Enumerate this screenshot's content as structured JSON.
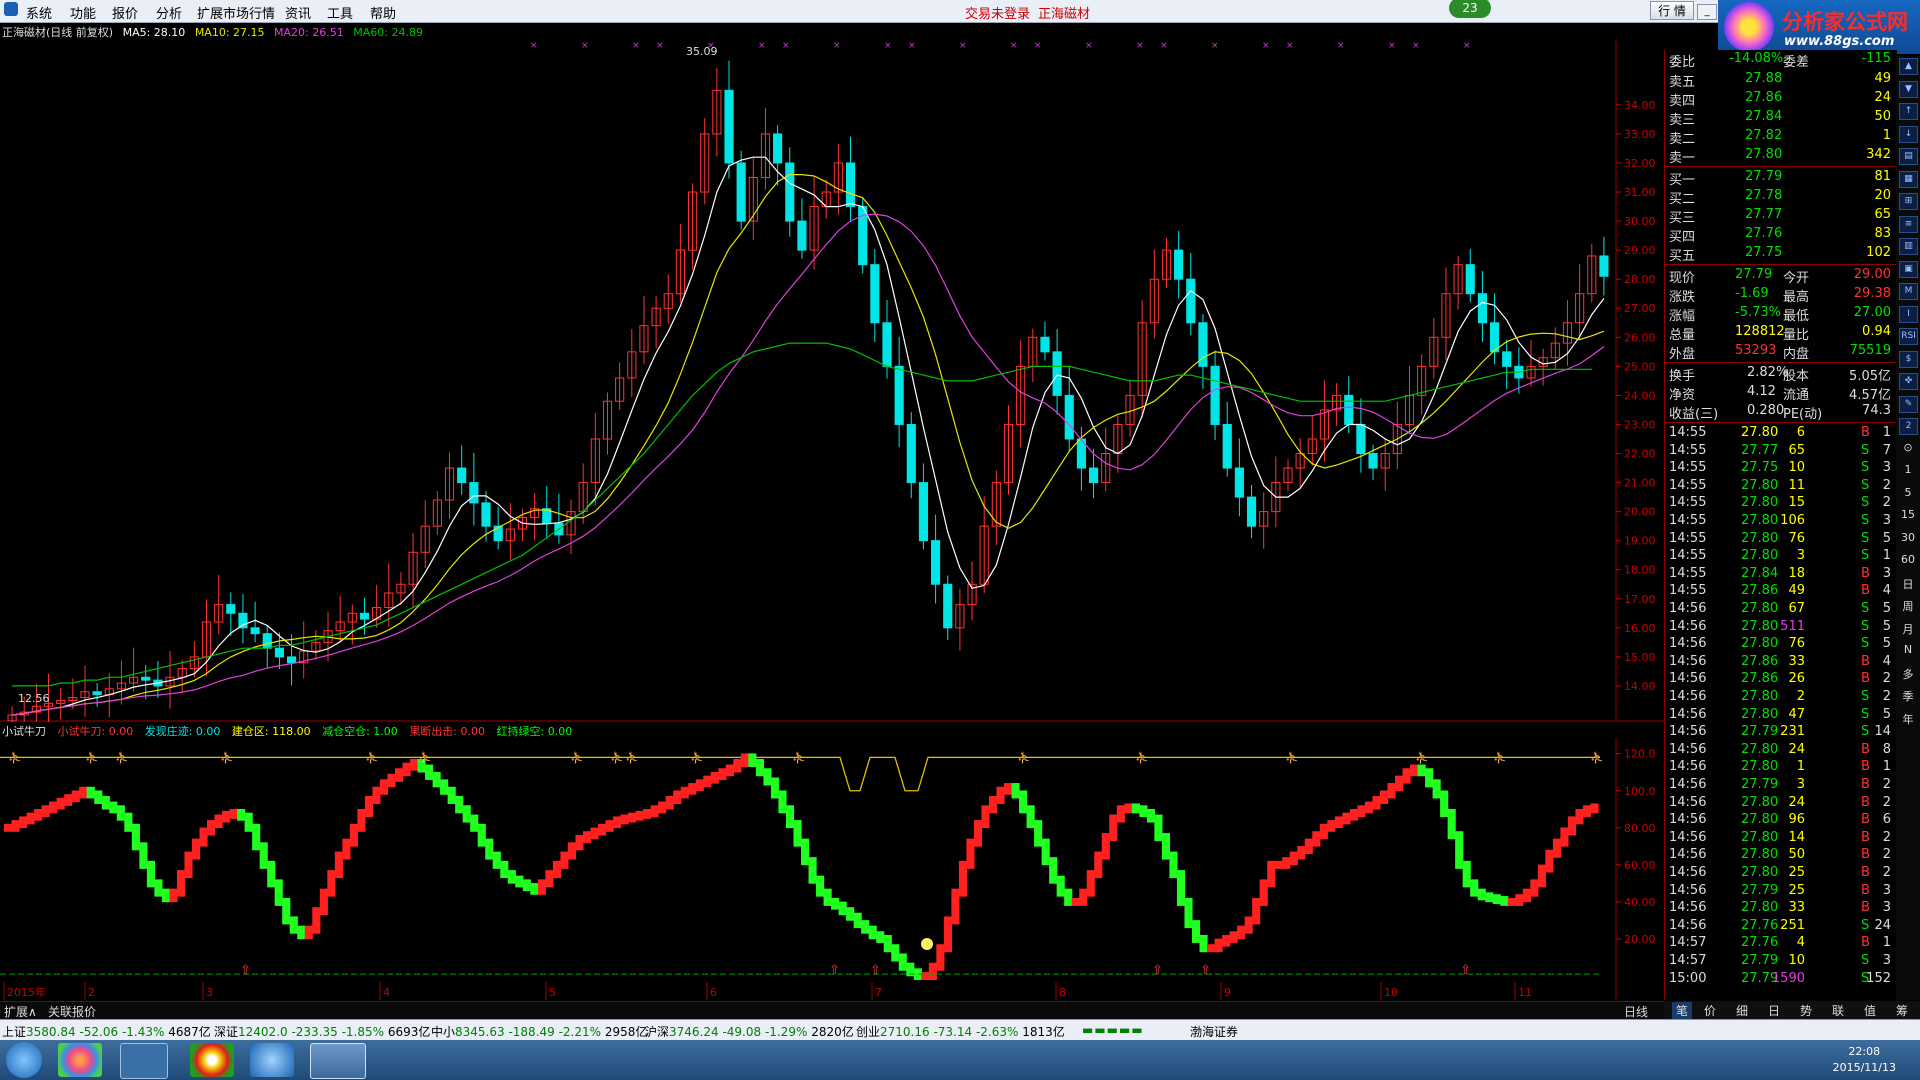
{
  "menu": {
    "items": [
      "系统",
      "功能",
      "报价",
      "分析",
      "扩展市场行情",
      "资讯",
      "工具",
      "帮助"
    ],
    "notice_login": "交易未登录",
    "notice_stock": "正海磁材",
    "bubble_count": "23",
    "hq_button": "行 情",
    "logo_text": "分析家公式网",
    "logo_url": "www.88gs.com",
    "window_controls": [
      "_",
      "▫",
      "×"
    ]
  },
  "main_chart": {
    "title": "正海磁材(日线 前复权)",
    "ma5": "MA5: 28.10",
    "ma10": "MA10: 27.15",
    "ma20": "MA20: 26.51",
    "ma60": "MA60: 24.89",
    "high_label": "35.09",
    "low_label": "12.56",
    "colors": {
      "up": "#ff3333",
      "down": "#00e5e5",
      "ma5": "#ffffff",
      "ma10": "#e6e600",
      "ma20": "#e040e0",
      "ma60": "#00c000",
      "axis": "#cc0000"
    }
  },
  "indicator": {
    "name": "小试牛刀",
    "params": [
      {
        "label": "小试牛刀: 0.00",
        "color": "#ff3333"
      },
      {
        "label": "发现庄迹: 0.00",
        "color": "#00e5e5"
      },
      {
        "label": "建仓区: 118.00",
        "color": "#ffff00"
      },
      {
        "label": "减仓空仓: 1.00",
        "color": "#00ff00"
      },
      {
        "label": "果断出击: 0.00",
        "color": "#ff3333"
      },
      {
        "label": "红持绿空: 0.00",
        "color": "#00ff00"
      }
    ]
  },
  "chart_data": [
    {
      "type": "candlestick",
      "title": "正海磁材(日线 前复权)",
      "y_ticks": [
        "34.00",
        "33.00",
        "32.00",
        "31.00",
        "30.00",
        "29.00",
        "28.00",
        "27.00",
        "26.00",
        "25.00",
        "24.00",
        "23.00",
        "22.00",
        "21.00",
        "20.00",
        "19.00",
        "18.00",
        "17.00",
        "16.00",
        "15.00",
        "14.00"
      ],
      "ylim": [
        13.0,
        35.2
      ],
      "x_labels": [
        "2015年",
        "2",
        "3",
        "4",
        "5",
        "6",
        "7",
        "8",
        "9",
        "10",
        "11"
      ],
      "close": [
        13.0,
        13.1,
        13.3,
        13.4,
        13.5,
        13.6,
        13.8,
        13.7,
        13.9,
        14.1,
        14.3,
        14.2,
        14.0,
        14.3,
        14.6,
        15.0,
        16.2,
        16.8,
        16.5,
        16.0,
        15.8,
        15.3,
        15.0,
        14.8,
        15.2,
        15.5,
        15.9,
        16.2,
        16.5,
        16.3,
        16.7,
        17.2,
        17.5,
        18.6,
        19.5,
        20.4,
        21.5,
        21.0,
        20.3,
        19.5,
        19.0,
        19.4,
        19.8,
        20.1,
        19.6,
        19.2,
        20.0,
        21.0,
        22.5,
        23.8,
        24.6,
        25.5,
        26.4,
        27.0,
        27.5,
        29.0,
        31.0,
        33.0,
        34.5,
        32.0,
        30.0,
        31.5,
        33.0,
        32.0,
        30.0,
        29.0,
        30.5,
        31.0,
        32.0,
        30.5,
        28.5,
        26.5,
        25.0,
        23.0,
        21.0,
        19.0,
        17.5,
        16.0,
        16.8,
        17.5,
        19.5,
        21.0,
        23.0,
        25.0,
        26.0,
        25.5,
        24.0,
        22.5,
        21.5,
        21.0,
        22.0,
        23.0,
        24.0,
        26.5,
        28.0,
        29.0,
        28.0,
        26.5,
        25.0,
        23.0,
        21.5,
        20.5,
        19.5,
        20.0,
        21.0,
        21.5,
        22.0,
        22.5,
        23.5,
        24.0,
        23.0,
        22.0,
        21.5,
        22.0,
        23.0,
        24.0,
        25.0,
        26.0,
        27.5,
        28.5,
        27.5,
        26.5,
        25.5,
        25.0,
        24.6,
        25.0,
        25.3,
        25.8,
        26.5,
        27.5,
        28.8,
        28.1
      ],
      "ma60_approx": [
        14.0,
        14.0,
        14.0,
        14.0,
        14.1,
        14.1,
        14.2,
        14.2,
        14.3,
        14.3,
        14.4,
        14.5,
        14.6,
        14.7,
        14.8,
        14.9,
        15.0,
        15.1,
        15.2,
        15.3,
        15.3,
        15.3,
        15.4,
        15.4,
        15.5,
        15.6,
        15.7,
        15.8,
        15.9,
        16.0,
        16.1,
        16.3,
        16.5,
        16.7,
        16.9,
        17.1,
        17.3,
        17.5,
        17.7,
        17.9,
        18.1,
        18.3,
        18.5,
        18.8,
        19.1,
        19.4,
        19.7,
        20.0,
        20.4,
        20.8,
        21.2,
        21.6,
        22.0,
        22.5,
        23.0,
        23.5,
        24.0,
        24.4,
        24.8,
        25.1,
        25.3,
        25.5,
        25.6,
        25.7,
        25.8,
        25.8,
        25.8,
        25.8,
        25.7,
        25.6,
        25.4,
        25.2,
        25.0,
        24.9,
        24.8,
        24.7,
        24.6,
        24.5,
        24.5,
        24.5,
        24.6,
        24.7,
        24.8,
        24.9,
        25.0,
        25.0,
        25.0,
        25.0,
        24.9,
        24.8,
        24.7,
        24.6,
        24.5,
        24.5,
        24.5,
        24.6,
        24.7,
        24.7,
        24.6,
        24.5,
        24.4,
        24.3,
        24.2,
        24.1,
        24.0,
        23.9,
        23.8,
        23.8,
        23.8,
        23.8,
        23.8,
        23.8,
        23.8,
        23.8,
        23.9,
        24.0,
        24.1,
        24.2,
        24.3,
        24.4,
        24.5,
        24.6,
        24.7,
        24.8,
        24.8,
        24.9,
        24.9,
        24.9,
        24.9,
        24.9,
        24.9
      ]
    },
    {
      "type": "line",
      "title": "小试牛刀",
      "y_ticks": [
        "120.0",
        "100.0",
        "80.00",
        "60.00",
        "40.00",
        "20.00"
      ],
      "ylim": [
        0,
        122
      ],
      "values": [
        80,
        82,
        84,
        86,
        88,
        90,
        92,
        94,
        96,
        98,
        100,
        98,
        95,
        92,
        90,
        86,
        80,
        70,
        60,
        50,
        45,
        42,
        45,
        55,
        65,
        72,
        78,
        82,
        85,
        87,
        88,
        86,
        80,
        70,
        60,
        50,
        40,
        30,
        25,
        22,
        25,
        35,
        45,
        55,
        65,
        72,
        80,
        88,
        95,
        100,
        104,
        107,
        110,
        113,
        115,
        112,
        108,
        104,
        100,
        95,
        90,
        85,
        80,
        72,
        65,
        60,
        55,
        52,
        50,
        48,
        46,
        50,
        55,
        60,
        65,
        70,
        74,
        76,
        78,
        80,
        82,
        84,
        85,
        86,
        87,
        88,
        90,
        92,
        95,
        98,
        100,
        102,
        104,
        106,
        108,
        110,
        112,
        115,
        118,
        115,
        110,
        105,
        98,
        90,
        82,
        72,
        62,
        52,
        45,
        40,
        38,
        35,
        32,
        28,
        25,
        22,
        20,
        15,
        10,
        5,
        2,
        0,
        0,
        5,
        15,
        30,
        45,
        60,
        72,
        82,
        90,
        95,
        100,
        102,
        98,
        90,
        82,
        72,
        62,
        52,
        45,
        40,
        40,
        45,
        55,
        65,
        75,
        85,
        90,
        91,
        90,
        88,
        85,
        75,
        65,
        55,
        40,
        28,
        20,
        15,
        15,
        18,
        20,
        22,
        25,
        30,
        40,
        50,
        60,
        60,
        62,
        65,
        68,
        72,
        76,
        80,
        82,
        84,
        86,
        88,
        90,
        92,
        95,
        98,
        102,
        106,
        110,
        112,
        110,
        104,
        98,
        88,
        76,
        60,
        50,
        45,
        43,
        42,
        41,
        40,
        40,
        42,
        45,
        50,
        58,
        66,
        72,
        78,
        84,
        88,
        90,
        91
      ]
    }
  ],
  "quote_panel": {
    "weibi": {
      "label": "委比",
      "value": "-14.08%",
      "label2": "委差",
      "value2": "-115"
    },
    "sells": [
      {
        "label": "卖五",
        "price": "27.88",
        "vol": "49"
      },
      {
        "label": "卖四",
        "price": "27.86",
        "vol": "24"
      },
      {
        "label": "卖三",
        "price": "27.84",
        "vol": "50"
      },
      {
        "label": "卖二",
        "price": "27.82",
        "vol": "1"
      },
      {
        "label": "卖一",
        "price": "27.80",
        "vol": "342"
      }
    ],
    "buys": [
      {
        "label": "买一",
        "price": "27.79",
        "vol": "81"
      },
      {
        "label": "买二",
        "price": "27.78",
        "vol": "20"
      },
      {
        "label": "买三",
        "price": "27.77",
        "vol": "65"
      },
      {
        "label": "买四",
        "price": "27.76",
        "vol": "83"
      },
      {
        "label": "买五",
        "price": "27.75",
        "vol": "102"
      }
    ],
    "stats": [
      {
        "l1": "现价",
        "v1": "27.79",
        "c1": "#00e000",
        "l2": "今开",
        "v2": "29.00",
        "c2": "#ff3333"
      },
      {
        "l1": "涨跌",
        "v1": "-1.69",
        "c1": "#00e000",
        "l2": "最高",
        "v2": "29.38",
        "c2": "#ff3333"
      },
      {
        "l1": "涨幅",
        "v1": "-5.73%",
        "c1": "#00e000",
        "l2": "最低",
        "v2": "27.00",
        "c2": "#00e000"
      },
      {
        "l1": "总量",
        "v1": "128812",
        "c1": "#ffff00",
        "l2": "量比",
        "v2": "0.94",
        "c2": "#ffff00"
      },
      {
        "l1": "外盘",
        "v1": "53293",
        "c1": "#ff3333",
        "l2": "内盘",
        "v2": "75519",
        "c2": "#00e000"
      }
    ],
    "fund": [
      {
        "l1": "换手",
        "v1": "2.82%",
        "l2": "股本",
        "v2": "5.05亿"
      },
      {
        "l1": "净资",
        "v1": "4.12",
        "l2": "流通",
        "v2": "4.57亿"
      },
      {
        "l1": "收益(三)",
        "v1": "0.280",
        "l2": "PE(动)",
        "v2": "74.3"
      }
    ],
    "ticks": [
      {
        "t": "14:55",
        "p": "27.80",
        "v": "6",
        "bs": "B",
        "n": "1",
        "pc": "#ffff00",
        "vc": "#ffff00"
      },
      {
        "t": "14:55",
        "p": "27.77",
        "v": "65",
        "bs": "S",
        "n": "7",
        "pc": "#00e000",
        "vc": "#ffff00"
      },
      {
        "t": "14:55",
        "p": "27.75",
        "v": "10",
        "bs": "S",
        "n": "3",
        "pc": "#00e000",
        "vc": "#ffff00"
      },
      {
        "t": "14:55",
        "p": "27.80",
        "v": "11",
        "bs": "S",
        "n": "2",
        "pc": "#00e000",
        "vc": "#ffff00"
      },
      {
        "t": "14:55",
        "p": "27.80",
        "v": "15",
        "bs": "S",
        "n": "2",
        "pc": "#00e000",
        "vc": "#ffff00"
      },
      {
        "t": "14:55",
        "p": "27.80",
        "v": "106",
        "bs": "S",
        "n": "3",
        "pc": "#00e000",
        "vc": "#ffff00"
      },
      {
        "t": "14:55",
        "p": "27.80",
        "v": "76",
        "bs": "S",
        "n": "5",
        "pc": "#00e000",
        "vc": "#ffff00"
      },
      {
        "t": "14:55",
        "p": "27.80",
        "v": "3",
        "bs": "S",
        "n": "1",
        "pc": "#00e000",
        "vc": "#ffff00"
      },
      {
        "t": "14:55",
        "p": "27.84",
        "v": "18",
        "bs": "B",
        "n": "3",
        "pc": "#00e000",
        "vc": "#ffff00"
      },
      {
        "t": "14:55",
        "p": "27.86",
        "v": "49",
        "bs": "B",
        "n": "4",
        "pc": "#00e000",
        "vc": "#ffff00"
      },
      {
        "t": "14:56",
        "p": "27.80",
        "v": "67",
        "bs": "S",
        "n": "5",
        "pc": "#00e000",
        "vc": "#ffff00"
      },
      {
        "t": "14:56",
        "p": "27.80",
        "v": "511",
        "bs": "S",
        "n": "5",
        "pc": "#00e000",
        "vc": "#e040e0"
      },
      {
        "t": "14:56",
        "p": "27.80",
        "v": "76",
        "bs": "S",
        "n": "5",
        "pc": "#00e000",
        "vc": "#ffff00"
      },
      {
        "t": "14:56",
        "p": "27.86",
        "v": "33",
        "bs": "B",
        "n": "4",
        "pc": "#00e000",
        "vc": "#ffff00"
      },
      {
        "t": "14:56",
        "p": "27.86",
        "v": "26",
        "bs": "B",
        "n": "2",
        "pc": "#00e000",
        "vc": "#ffff00"
      },
      {
        "t": "14:56",
        "p": "27.80",
        "v": "2",
        "bs": "S",
        "n": "2",
        "pc": "#00e000",
        "vc": "#ffff00"
      },
      {
        "t": "14:56",
        "p": "27.80",
        "v": "47",
        "bs": "S",
        "n": "5",
        "pc": "#00e000",
        "vc": "#ffff00"
      },
      {
        "t": "14:56",
        "p": "27.79",
        "v": "231",
        "bs": "S",
        "n": "14",
        "pc": "#00e000",
        "vc": "#ffff00"
      },
      {
        "t": "14:56",
        "p": "27.80",
        "v": "24",
        "bs": "B",
        "n": "8",
        "pc": "#00e000",
        "vc": "#ffff00"
      },
      {
        "t": "14:56",
        "p": "27.80",
        "v": "1",
        "bs": "B",
        "n": "1",
        "pc": "#00e000",
        "vc": "#ffff00"
      },
      {
        "t": "14:56",
        "p": "27.79",
        "v": "3",
        "bs": "B",
        "n": "2",
        "pc": "#00e000",
        "vc": "#ffff00"
      },
      {
        "t": "14:56",
        "p": "27.80",
        "v": "24",
        "bs": "B",
        "n": "2",
        "pc": "#00e000",
        "vc": "#ffff00"
      },
      {
        "t": "14:56",
        "p": "27.80",
        "v": "96",
        "bs": "B",
        "n": "6",
        "pc": "#00e000",
        "vc": "#ffff00"
      },
      {
        "t": "14:56",
        "p": "27.80",
        "v": "14",
        "bs": "B",
        "n": "2",
        "pc": "#00e000",
        "vc": "#ffff00"
      },
      {
        "t": "14:56",
        "p": "27.80",
        "v": "50",
        "bs": "B",
        "n": "2",
        "pc": "#00e000",
        "vc": "#ffff00"
      },
      {
        "t": "14:56",
        "p": "27.80",
        "v": "25",
        "bs": "B",
        "n": "2",
        "pc": "#00e000",
        "vc": "#ffff00"
      },
      {
        "t": "14:56",
        "p": "27.79",
        "v": "25",
        "bs": "B",
        "n": "3",
        "pc": "#00e000",
        "vc": "#ffff00"
      },
      {
        "t": "14:56",
        "p": "27.80",
        "v": "33",
        "bs": "B",
        "n": "3",
        "pc": "#00e000",
        "vc": "#ffff00"
      },
      {
        "t": "14:56",
        "p": "27.76",
        "v": "251",
        "bs": "S",
        "n": "24",
        "pc": "#00e000",
        "vc": "#ffff00"
      },
      {
        "t": "14:57",
        "p": "27.76",
        "v": "4",
        "bs": "B",
        "n": "1",
        "pc": "#00e000",
        "vc": "#ffff00"
      },
      {
        "t": "14:57",
        "p": "27.79",
        "v": "10",
        "bs": "S",
        "n": "3",
        "pc": "#00e000",
        "vc": "#ffff00"
      },
      {
        "t": "15:00",
        "p": "27.79",
        "v": "1590",
        "bs": "S",
        "n": "152",
        "pc": "#00e000",
        "vc": "#e040e0"
      }
    ]
  },
  "side_icons": [
    "▲",
    "▼",
    "↑",
    "↓",
    "▤",
    "▦",
    "⊞",
    "≡",
    "▥",
    "▣",
    "M",
    "I",
    "RSI",
    "$",
    "✜",
    "✎",
    "2",
    "⊙",
    "1",
    "5",
    "15",
    "30",
    "60",
    "日",
    "周",
    "月",
    "N",
    "多",
    "季",
    "年"
  ],
  "bottom_tabs": {
    "left": [
      "扩展∧",
      "关联报价"
    ],
    "period": "日线",
    "right": [
      "笔",
      "价",
      "细",
      "日",
      "势",
      "联",
      "值",
      "筹"
    ]
  },
  "status": {
    "items": [
      {
        "name": "上证",
        "v": "3580.84",
        "c": "-52.06",
        "p": "-1.43%",
        "a": "4687亿"
      },
      {
        "name": "深证",
        "v": "12402.0",
        "c": "-233.35",
        "p": "-1.85%",
        "a": "6693亿"
      },
      {
        "name": "中小",
        "v": "8345.63",
        "c": "-188.49",
        "p": "-2.21%",
        "a": "2958亿"
      },
      {
        "name": "沪深",
        "v": "3746.24",
        "c": "-49.08",
        "p": "-1.29%",
        "a": "2820亿"
      },
      {
        "name": "创业",
        "v": "2710.16",
        "c": "-73.14",
        "p": "-2.63%",
        "a": "1813亿"
      }
    ],
    "broker": "渤海证券"
  },
  "taskbar": {
    "time": "22:08",
    "date": "2015/11/13"
  }
}
